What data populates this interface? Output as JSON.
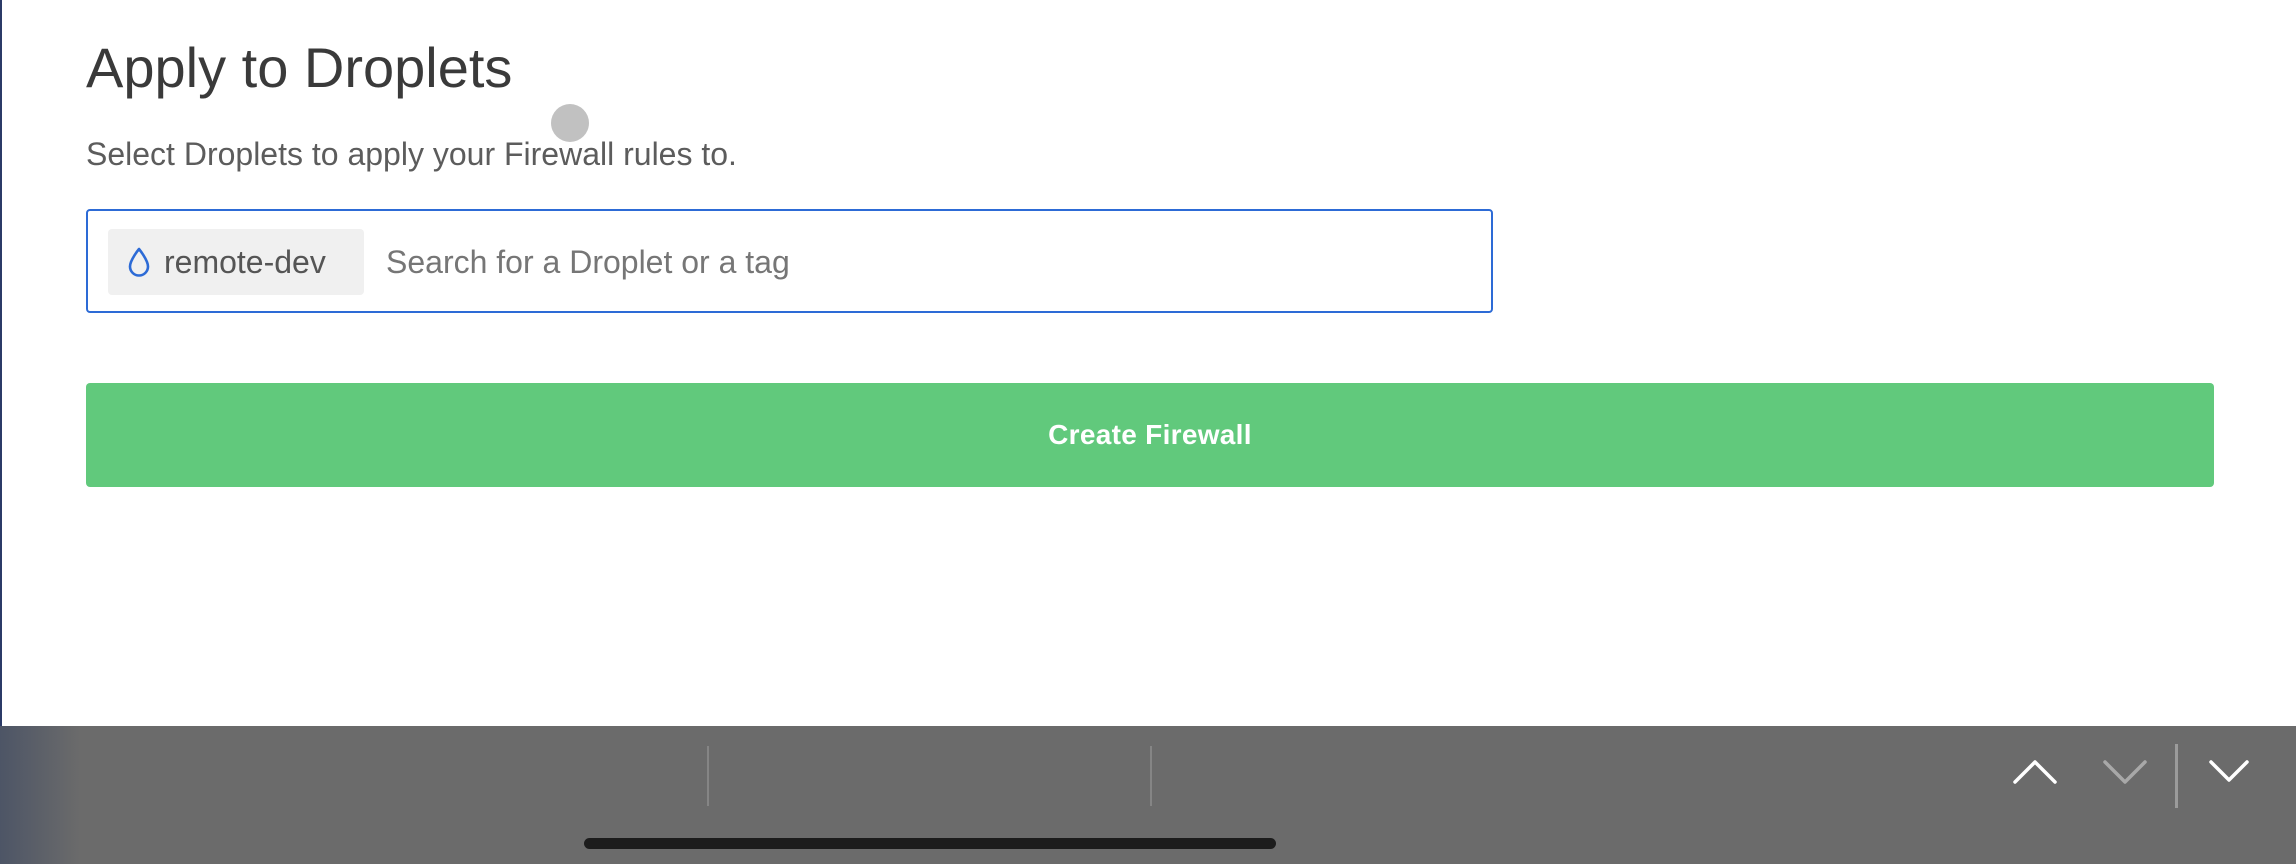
{
  "section": {
    "title": "Apply to Droplets",
    "subtitle": "Select Droplets to apply your Firewall rules to."
  },
  "search": {
    "selected_tag": {
      "icon": "droplet-icon",
      "label": "remote-dev"
    },
    "placeholder": "Search for a Droplet or a tag",
    "value": ""
  },
  "actions": {
    "create_label": "Create Firewall"
  },
  "keyboard_toolbar": {
    "prev_icon": "chevron-up-icon",
    "next_icon": "chevron-down-icon",
    "done_icon": "chevron-down-icon"
  },
  "colors": {
    "accent_blue": "#2d6bd6",
    "create_green": "#61c97c",
    "toolbar_gray": "#6b6b6b"
  }
}
